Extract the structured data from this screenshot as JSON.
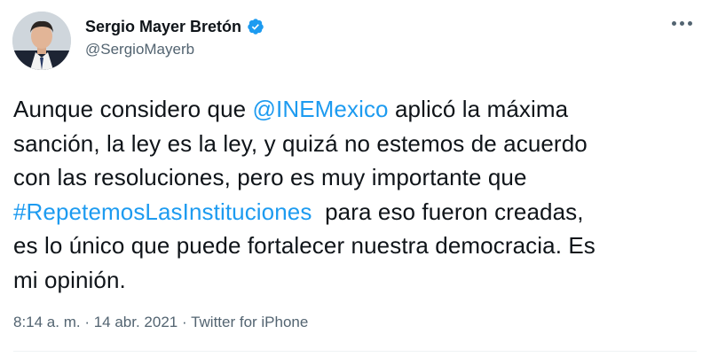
{
  "author": {
    "name": "Sergio Mayer Bretón",
    "handle": "@SergioMayerb",
    "verified_color": "#1d9bf0"
  },
  "tweet": {
    "line1": {
      "pre": "Aunque considero que ",
      "mention": "@INEMexico",
      "post": " aplicó la máxima"
    },
    "line2": "sanción, la ley es la ley, y quizá no estemos de acuerdo",
    "line3": "con las resoluciones, pero es muy importante que",
    "line4": {
      "hashtag": "#RepetemosLasInstituciones",
      "post": "  para eso fueron creadas,"
    },
    "line5": "es lo único que puede fortalecer nuestra democracia. Es",
    "line6": "mi opinión."
  },
  "meta": {
    "time": "8:14 a. m.",
    "sep1": " · ",
    "date": "14 abr. 2021",
    "sep2": " · ",
    "source": "Twitter for iPhone"
  },
  "colors": {
    "link": "#1d9bf0",
    "secondary_text": "#536471",
    "primary_text": "#0f1419"
  },
  "icons": {
    "verified": "verified-badge-icon",
    "more": "more-options-icon"
  }
}
